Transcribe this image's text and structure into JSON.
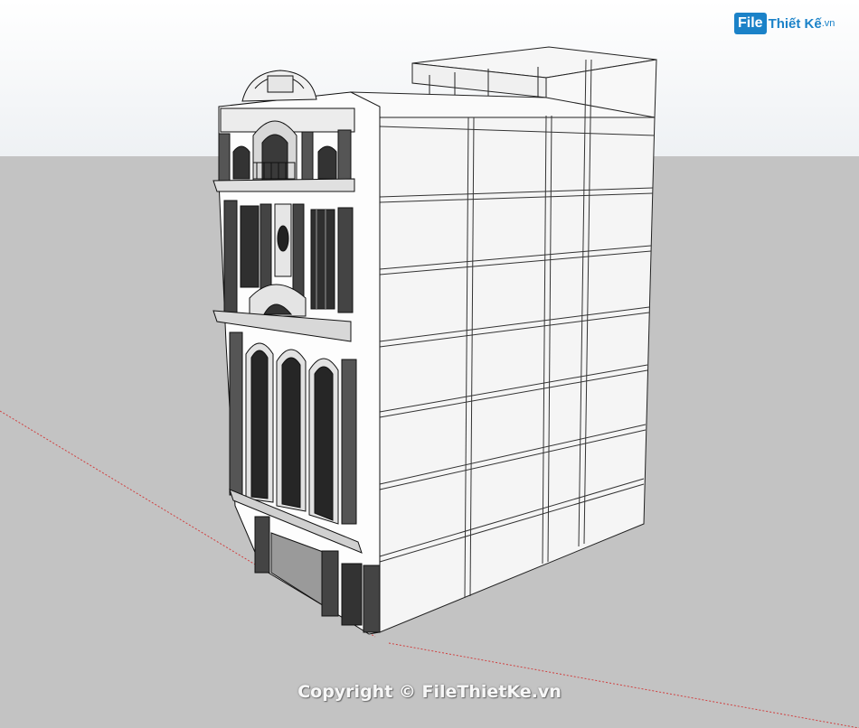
{
  "watermark": {
    "logo_file": "File",
    "logo_brand": "Thiết Kế",
    "logo_tld": ".vn",
    "copyright": "Copyright © FileThietKe.vn"
  },
  "colors": {
    "sky": "#ffffff",
    "ground": "#c3c3c3",
    "facade_edge": "#1a1a1a",
    "wall": "#f4f4f4",
    "axis_red": "#d04040",
    "brand_blue": "#1b82c8"
  },
  "model": {
    "subject": "townhouse-3d-model",
    "facade_style": "neoclassical"
  }
}
